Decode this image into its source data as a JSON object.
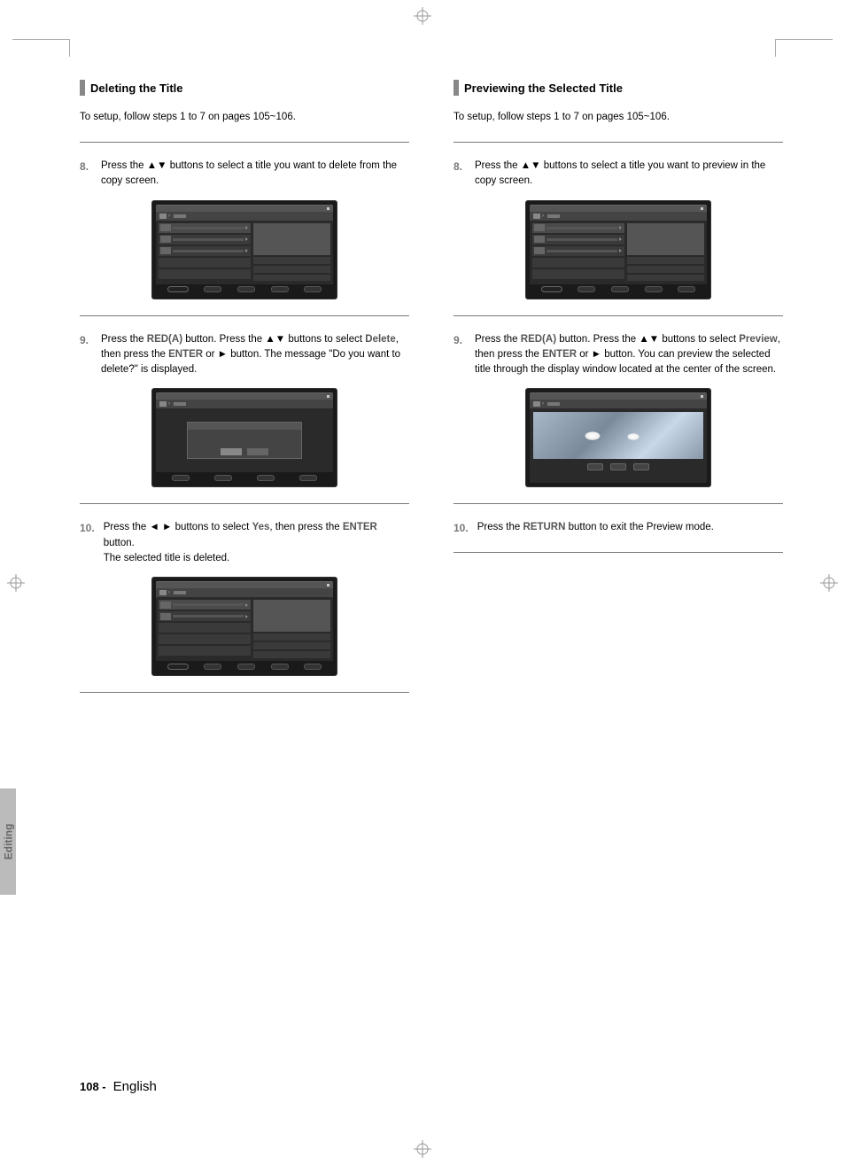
{
  "page": {
    "number": "108 -",
    "language": "English",
    "side_tab": "Editing"
  },
  "left": {
    "title": "Deleting the Title",
    "setup": "To setup, follow steps 1 to 7 on pages 105~106.",
    "steps": [
      {
        "num": "8.",
        "text_parts": [
          "Press the ▲▼ buttons to select a title you want to delete from the copy screen."
        ]
      },
      {
        "num": "9.",
        "text_parts": [
          "Press the ",
          "RED(A)",
          " button. Press the ▲▼ buttons to select ",
          "Delete",
          ", then press the ",
          "ENTER",
          " or ► button. The message \"Do you want to delete?\" is displayed."
        ]
      },
      {
        "num": "10.",
        "text_parts": [
          "Press the ◄ ► buttons to select ",
          "Yes",
          ", then press the ",
          "ENTER",
          " button.",
          " The selected title is deleted."
        ]
      }
    ]
  },
  "right": {
    "title": "Previewing the Selected Title",
    "setup": "To setup, follow steps 1 to 7 on pages 105~106.",
    "steps": [
      {
        "num": "8.",
        "text_parts": [
          "Press the ▲▼ buttons to select a title you want to preview in the copy screen."
        ]
      },
      {
        "num": "9.",
        "text_parts": [
          "Press the ",
          "RED(A)",
          " button. Press the ▲▼ buttons to select ",
          "Preview",
          ", then press the ",
          "ENTER",
          " or ► button. You can preview the selected title through the display window located at the center of the screen."
        ]
      },
      {
        "num": "10.",
        "text_parts": [
          "Press the ",
          "RETURN",
          " button to exit the Preview mode."
        ]
      }
    ]
  }
}
